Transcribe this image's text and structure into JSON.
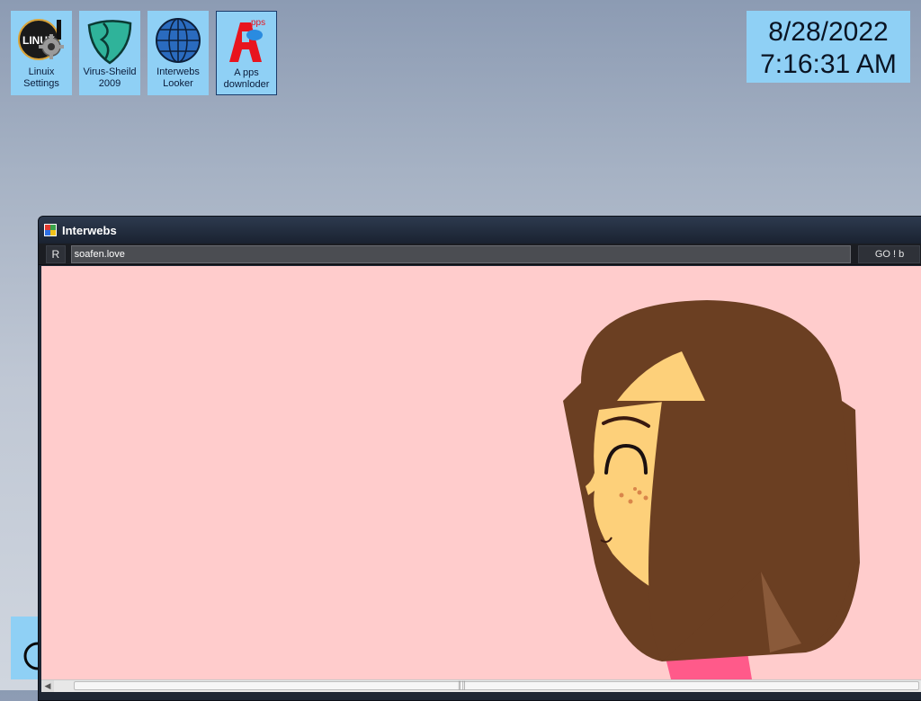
{
  "desktop": {
    "icons": [
      {
        "label": "Linuix\nSettings",
        "icon": "linux-settings-gear-icon"
      },
      {
        "label": "Virus-Sheild\n2009",
        "icon": "virus-shield-icon"
      },
      {
        "label": "Interwebs\nLooker",
        "icon": "globe-icon"
      },
      {
        "label": "A pps\ndownloder",
        "icon": "apps-downloader-icon",
        "badge": "pps"
      }
    ]
  },
  "clock": {
    "date": "8/28/2022",
    "time": "7:16:31 AM"
  },
  "window": {
    "title": "Interwebs",
    "refresh_label": "R",
    "url_value": "soafen.love",
    "go_label": "GO ! b",
    "content_bg": "#ffcccc"
  },
  "colors": {
    "icon_tile": "#8fd0f5",
    "titlebar": "#1e2633"
  }
}
